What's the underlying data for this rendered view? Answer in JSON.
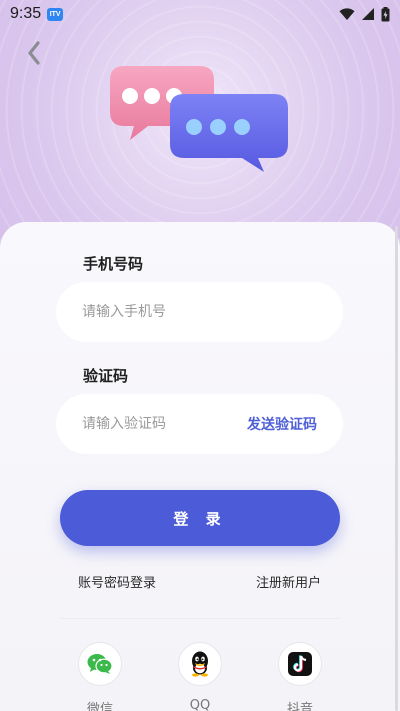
{
  "status_bar": {
    "time": "9:35",
    "badge_text": "ITV",
    "icons": [
      "wifi-icon",
      "signal-icon",
      "battery-icon"
    ]
  },
  "header": {
    "back_icon": "chevron-left-icon",
    "illustration": "chat-bubbles-illustration"
  },
  "form": {
    "phone": {
      "label": "手机号码",
      "placeholder": "请输入手机号",
      "value": ""
    },
    "code": {
      "label": "验证码",
      "placeholder": "请输入验证码",
      "value": "",
      "send_label": "发送验证码"
    },
    "login_label": "登 录",
    "password_login_label": "账号密码登录",
    "register_label": "注册新用户"
  },
  "social_login": [
    {
      "label": "微信",
      "icon": "wechat-icon"
    },
    {
      "label": "QQ",
      "icon": "qq-icon"
    },
    {
      "label": "抖音",
      "icon": "douyin-icon"
    }
  ],
  "colors": {
    "accent": "#4c5bd8",
    "send_code": "#4f5fd8",
    "wechat": "#3cb94b",
    "bubble_pink": "#f08aa9",
    "bubble_blue": "#6b6ff0"
  }
}
